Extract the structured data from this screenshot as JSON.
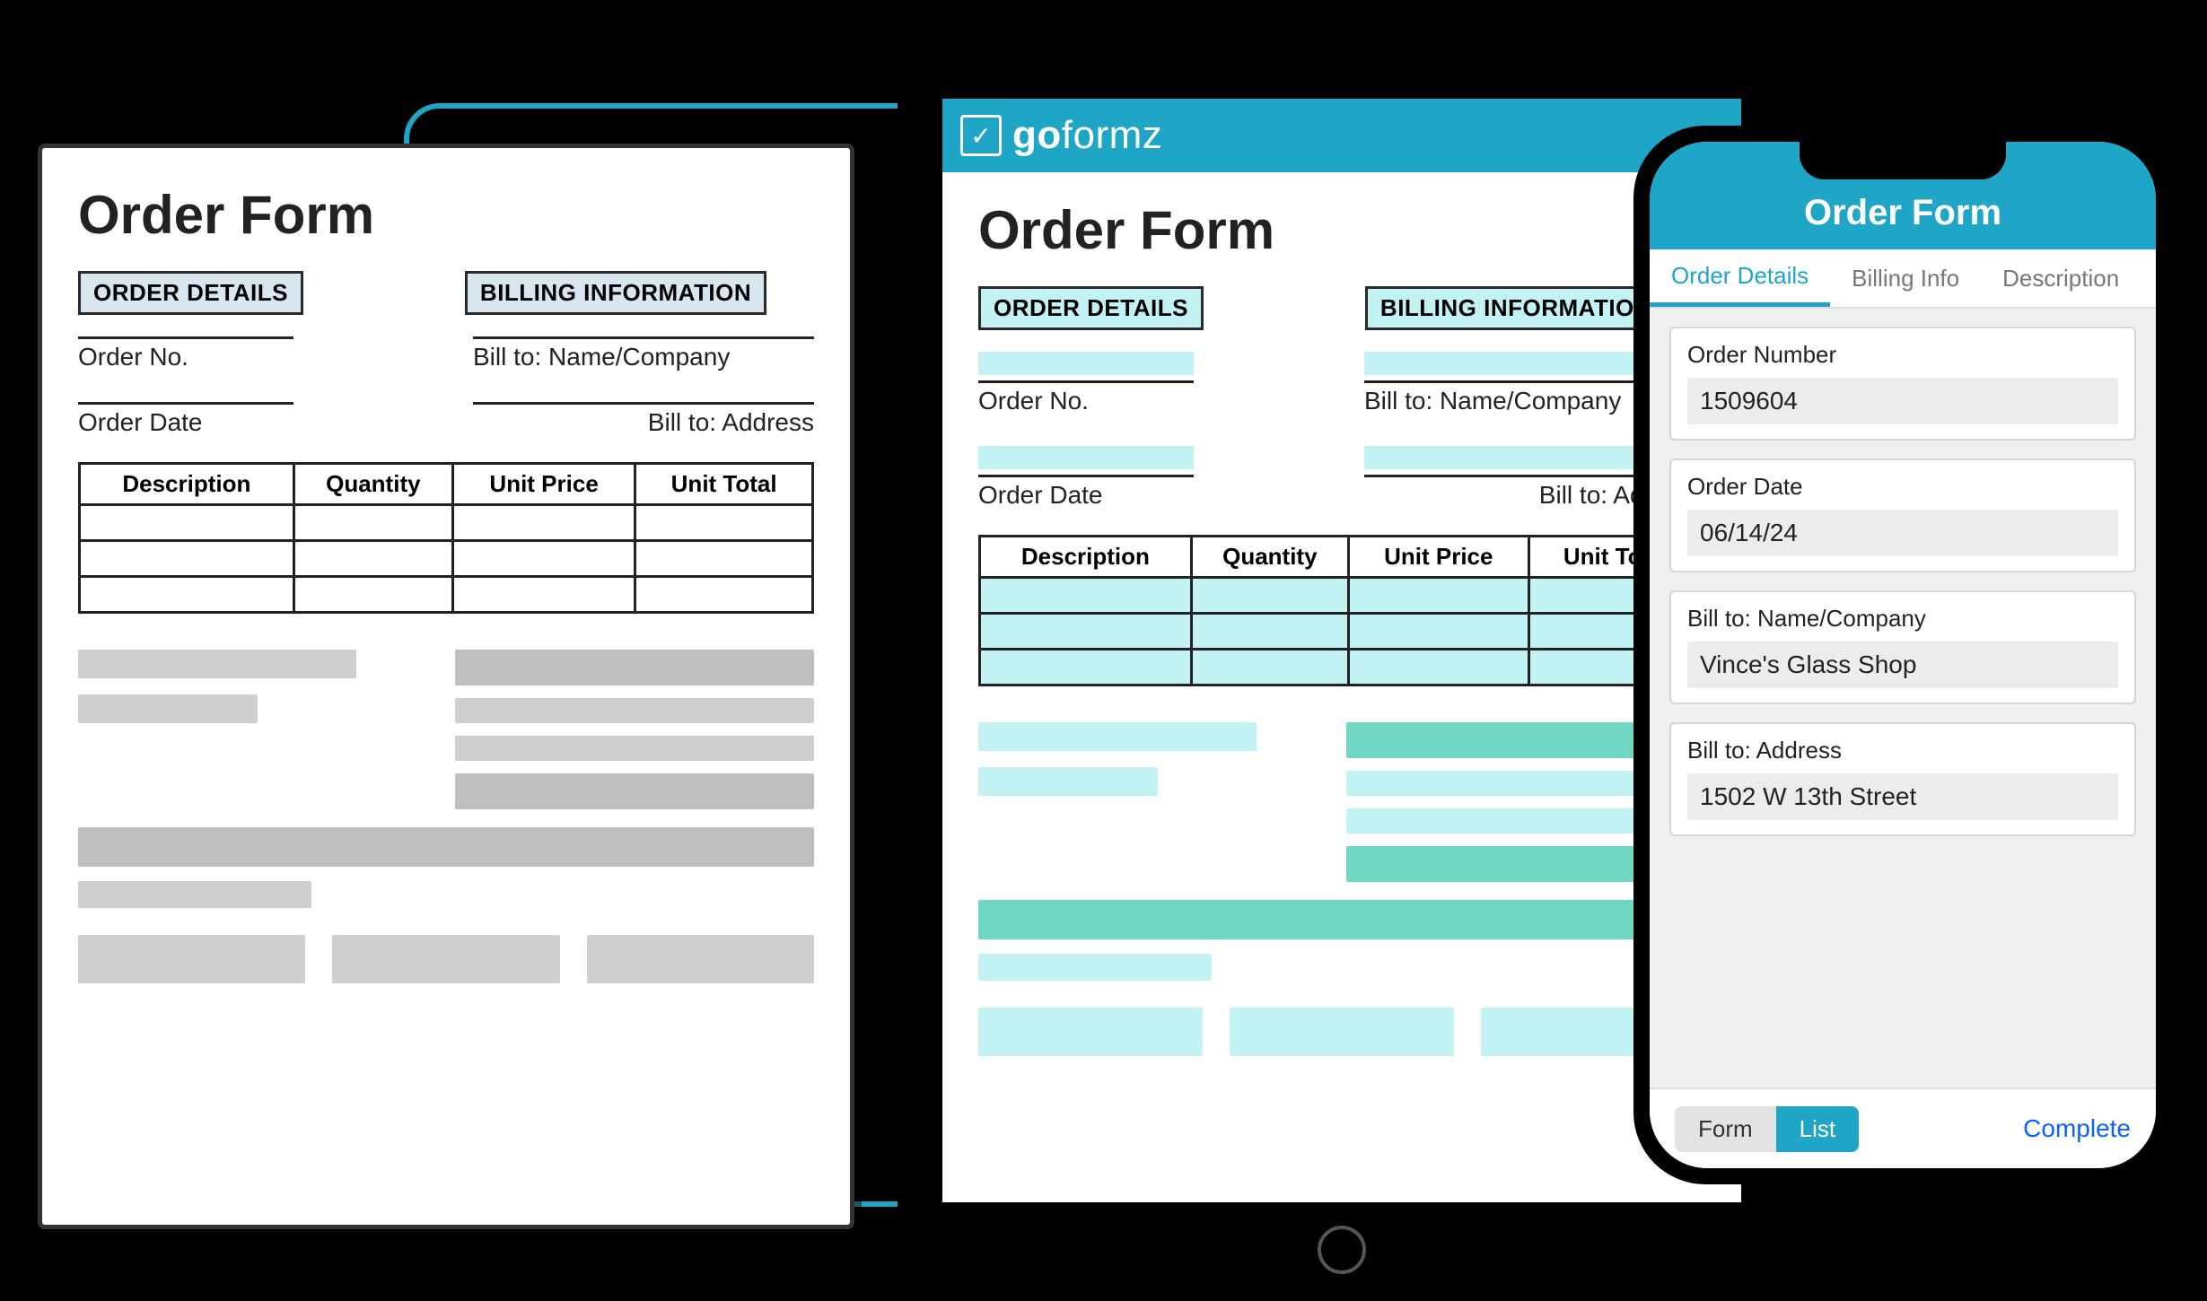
{
  "brand": {
    "name_prefix": "go",
    "name_suffix": "formz"
  },
  "form": {
    "title": "Order Form",
    "sections": {
      "order_details": "ORDER DETAILS",
      "billing_info": "BILLING INFORMATION"
    },
    "fields": {
      "order_no": "Order No.",
      "order_date": "Order Date",
      "bill_name": "Bill to: Name/Company",
      "bill_address": "Bill to: Address"
    },
    "table_headers": [
      "Description",
      "Quantity",
      "Unit Price",
      "Unit Total"
    ]
  },
  "phone": {
    "title": "Order Form",
    "tabs": [
      "Order Details",
      "Billing Info",
      "Description"
    ],
    "active_tab_index": 0,
    "fields": [
      {
        "label": "Order Number",
        "value": "1509604"
      },
      {
        "label": "Order Date",
        "value": "06/14/24"
      },
      {
        "label": "Bill to: Name/Company",
        "value": "Vince's Glass Shop"
      },
      {
        "label": "Bill to: Address",
        "value": "1502 W 13th Street"
      }
    ],
    "footer": {
      "seg": [
        "Form",
        "List"
      ],
      "active_seg_index": 1,
      "complete": "Complete"
    }
  }
}
